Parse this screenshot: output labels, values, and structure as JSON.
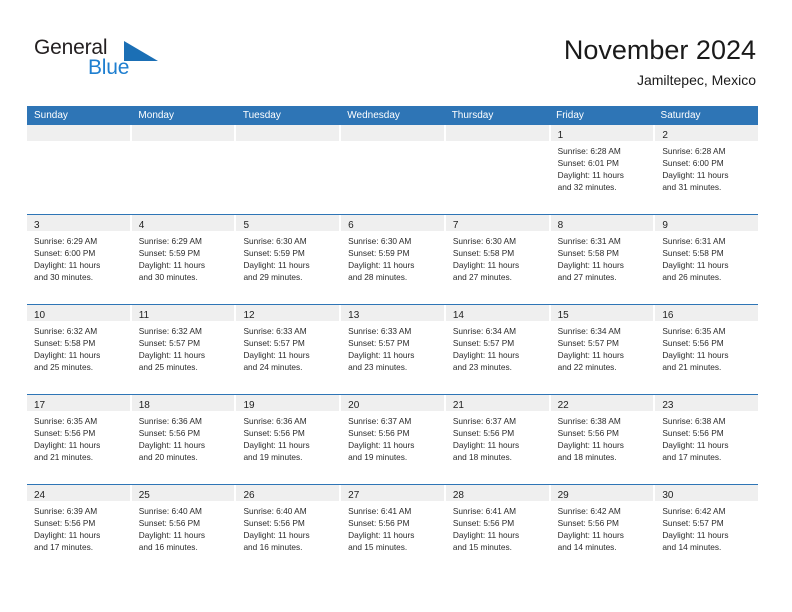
{
  "brand": {
    "word1": "General",
    "word2": "Blue",
    "accent_color": "#1b6fb5",
    "text_color": "#231f20"
  },
  "header": {
    "title": "November 2024",
    "subtitle": "Jamiltepec, Mexico"
  },
  "theme": {
    "header_blue": "#2e75b6",
    "daynum_band": "#efefef",
    "cell_background": "#ffffff",
    "text": "#222222"
  },
  "calendar": {
    "weekdays": [
      "Sunday",
      "Monday",
      "Tuesday",
      "Wednesday",
      "Thursday",
      "Friday",
      "Saturday"
    ],
    "weeks": [
      [
        {
          "day": "",
          "lines": []
        },
        {
          "day": "",
          "lines": []
        },
        {
          "day": "",
          "lines": []
        },
        {
          "day": "",
          "lines": []
        },
        {
          "day": "",
          "lines": []
        },
        {
          "day": "1",
          "lines": [
            "Sunrise: 6:28 AM",
            "Sunset: 6:01 PM",
            "Daylight: 11 hours",
            "and 32 minutes."
          ]
        },
        {
          "day": "2",
          "lines": [
            "Sunrise: 6:28 AM",
            "Sunset: 6:00 PM",
            "Daylight: 11 hours",
            "and 31 minutes."
          ]
        }
      ],
      [
        {
          "day": "3",
          "lines": [
            "Sunrise: 6:29 AM",
            "Sunset: 6:00 PM",
            "Daylight: 11 hours",
            "and 30 minutes."
          ]
        },
        {
          "day": "4",
          "lines": [
            "Sunrise: 6:29 AM",
            "Sunset: 5:59 PM",
            "Daylight: 11 hours",
            "and 30 minutes."
          ]
        },
        {
          "day": "5",
          "lines": [
            "Sunrise: 6:30 AM",
            "Sunset: 5:59 PM",
            "Daylight: 11 hours",
            "and 29 minutes."
          ]
        },
        {
          "day": "6",
          "lines": [
            "Sunrise: 6:30 AM",
            "Sunset: 5:59 PM",
            "Daylight: 11 hours",
            "and 28 minutes."
          ]
        },
        {
          "day": "7",
          "lines": [
            "Sunrise: 6:30 AM",
            "Sunset: 5:58 PM",
            "Daylight: 11 hours",
            "and 27 minutes."
          ]
        },
        {
          "day": "8",
          "lines": [
            "Sunrise: 6:31 AM",
            "Sunset: 5:58 PM",
            "Daylight: 11 hours",
            "and 27 minutes."
          ]
        },
        {
          "day": "9",
          "lines": [
            "Sunrise: 6:31 AM",
            "Sunset: 5:58 PM",
            "Daylight: 11 hours",
            "and 26 minutes."
          ]
        }
      ],
      [
        {
          "day": "10",
          "lines": [
            "Sunrise: 6:32 AM",
            "Sunset: 5:58 PM",
            "Daylight: 11 hours",
            "and 25 minutes."
          ]
        },
        {
          "day": "11",
          "lines": [
            "Sunrise: 6:32 AM",
            "Sunset: 5:57 PM",
            "Daylight: 11 hours",
            "and 25 minutes."
          ]
        },
        {
          "day": "12",
          "lines": [
            "Sunrise: 6:33 AM",
            "Sunset: 5:57 PM",
            "Daylight: 11 hours",
            "and 24 minutes."
          ]
        },
        {
          "day": "13",
          "lines": [
            "Sunrise: 6:33 AM",
            "Sunset: 5:57 PM",
            "Daylight: 11 hours",
            "and 23 minutes."
          ]
        },
        {
          "day": "14",
          "lines": [
            "Sunrise: 6:34 AM",
            "Sunset: 5:57 PM",
            "Daylight: 11 hours",
            "and 23 minutes."
          ]
        },
        {
          "day": "15",
          "lines": [
            "Sunrise: 6:34 AM",
            "Sunset: 5:57 PM",
            "Daylight: 11 hours",
            "and 22 minutes."
          ]
        },
        {
          "day": "16",
          "lines": [
            "Sunrise: 6:35 AM",
            "Sunset: 5:56 PM",
            "Daylight: 11 hours",
            "and 21 minutes."
          ]
        }
      ],
      [
        {
          "day": "17",
          "lines": [
            "Sunrise: 6:35 AM",
            "Sunset: 5:56 PM",
            "Daylight: 11 hours",
            "and 21 minutes."
          ]
        },
        {
          "day": "18",
          "lines": [
            "Sunrise: 6:36 AM",
            "Sunset: 5:56 PM",
            "Daylight: 11 hours",
            "and 20 minutes."
          ]
        },
        {
          "day": "19",
          "lines": [
            "Sunrise: 6:36 AM",
            "Sunset: 5:56 PM",
            "Daylight: 11 hours",
            "and 19 minutes."
          ]
        },
        {
          "day": "20",
          "lines": [
            "Sunrise: 6:37 AM",
            "Sunset: 5:56 PM",
            "Daylight: 11 hours",
            "and 19 minutes."
          ]
        },
        {
          "day": "21",
          "lines": [
            "Sunrise: 6:37 AM",
            "Sunset: 5:56 PM",
            "Daylight: 11 hours",
            "and 18 minutes."
          ]
        },
        {
          "day": "22",
          "lines": [
            "Sunrise: 6:38 AM",
            "Sunset: 5:56 PM",
            "Daylight: 11 hours",
            "and 18 minutes."
          ]
        },
        {
          "day": "23",
          "lines": [
            "Sunrise: 6:38 AM",
            "Sunset: 5:56 PM",
            "Daylight: 11 hours",
            "and 17 minutes."
          ]
        }
      ],
      [
        {
          "day": "24",
          "lines": [
            "Sunrise: 6:39 AM",
            "Sunset: 5:56 PM",
            "Daylight: 11 hours",
            "and 17 minutes."
          ]
        },
        {
          "day": "25",
          "lines": [
            "Sunrise: 6:40 AM",
            "Sunset: 5:56 PM",
            "Daylight: 11 hours",
            "and 16 minutes."
          ]
        },
        {
          "day": "26",
          "lines": [
            "Sunrise: 6:40 AM",
            "Sunset: 5:56 PM",
            "Daylight: 11 hours",
            "and 16 minutes."
          ]
        },
        {
          "day": "27",
          "lines": [
            "Sunrise: 6:41 AM",
            "Sunset: 5:56 PM",
            "Daylight: 11 hours",
            "and 15 minutes."
          ]
        },
        {
          "day": "28",
          "lines": [
            "Sunrise: 6:41 AM",
            "Sunset: 5:56 PM",
            "Daylight: 11 hours",
            "and 15 minutes."
          ]
        },
        {
          "day": "29",
          "lines": [
            "Sunrise: 6:42 AM",
            "Sunset: 5:56 PM",
            "Daylight: 11 hours",
            "and 14 minutes."
          ]
        },
        {
          "day": "30",
          "lines": [
            "Sunrise: 6:42 AM",
            "Sunset: 5:57 PM",
            "Daylight: 11 hours",
            "and 14 minutes."
          ]
        }
      ]
    ]
  }
}
